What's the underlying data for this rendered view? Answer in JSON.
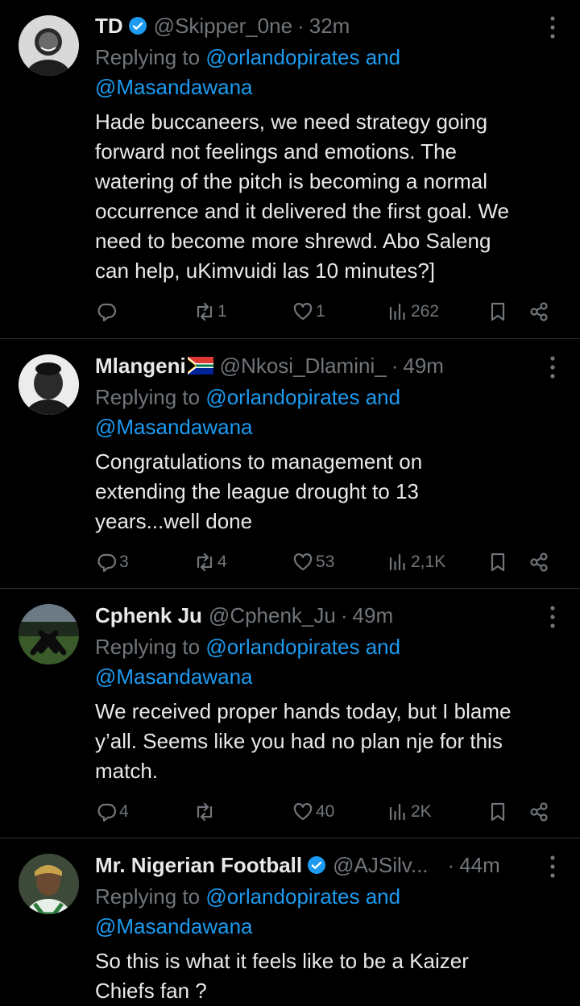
{
  "tweets": [
    {
      "name": "TD",
      "verified": true,
      "handle": "@Skipper_0ne",
      "time": "32m",
      "replying_prefix": "Replying to ",
      "replying_link1": "@orlandopirates and",
      "replying_link2": "@Masandawana",
      "text_lines": [
        "Hade buccaneers, we need strategy going",
        "forward not feelings and emotions. The",
        "watering of the pitch is becoming a normal",
        "occurrence and it delivered the first goal. We",
        "need to become more shrewd. Abo Saleng",
        "can help, uKimvuidi las 10 minutes?]"
      ],
      "replies": "",
      "retweets": "1",
      "likes": "1",
      "views": "262"
    },
    {
      "name": "Mlangeni",
      "flag": "south-africa-flag-icon",
      "handle": "@Nkosi_Dlamini_",
      "time": "49m",
      "replying_prefix": "Replying to ",
      "replying_link1": "@orlandopirates and",
      "replying_link2": "@Masandawana",
      "text_lines": [
        "Congratulations to management on",
        "extending the league drought to 13",
        "years...well done"
      ],
      "replies": "3",
      "retweets": "4",
      "likes": "53",
      "views": "2,1K"
    },
    {
      "name": "Cphenk Ju",
      "handle": "@Cphenk_Ju",
      "time": "49m",
      "replying_prefix": "Replying to ",
      "replying_link1": "@orlandopirates and",
      "replying_link2": "@Masandawana",
      "text_lines": [
        "We received proper hands today, but I blame",
        "y’all. Seems like you had no plan nje for this",
        "match."
      ],
      "replies": "4",
      "retweets": "",
      "likes": "40",
      "views": "2K"
    },
    {
      "name": "Mr. Nigerian Football",
      "verified": true,
      "handle": "@AJSilv...",
      "time": "44m",
      "replying_prefix": "Replying to ",
      "replying_link1": "@orlandopirates and",
      "replying_link2": "@Masandawana",
      "text_lines": [
        "So this is what it feels like to be a Kaizer",
        "Chiefs fan ?"
      ]
    }
  ],
  "colors": {
    "background": "#000000",
    "text": "#e7e9ea",
    "muted": "#71767b",
    "link": "#1d9bf0",
    "divider": "#2f3336"
  },
  "icons": {
    "verified": "verified-badge-icon",
    "more": "more-options-icon",
    "reply": "reply-icon",
    "retweet": "retweet-icon",
    "like": "heart-icon",
    "views": "views-chart-icon",
    "bookmark": "bookmark-icon",
    "share": "share-icon"
  }
}
